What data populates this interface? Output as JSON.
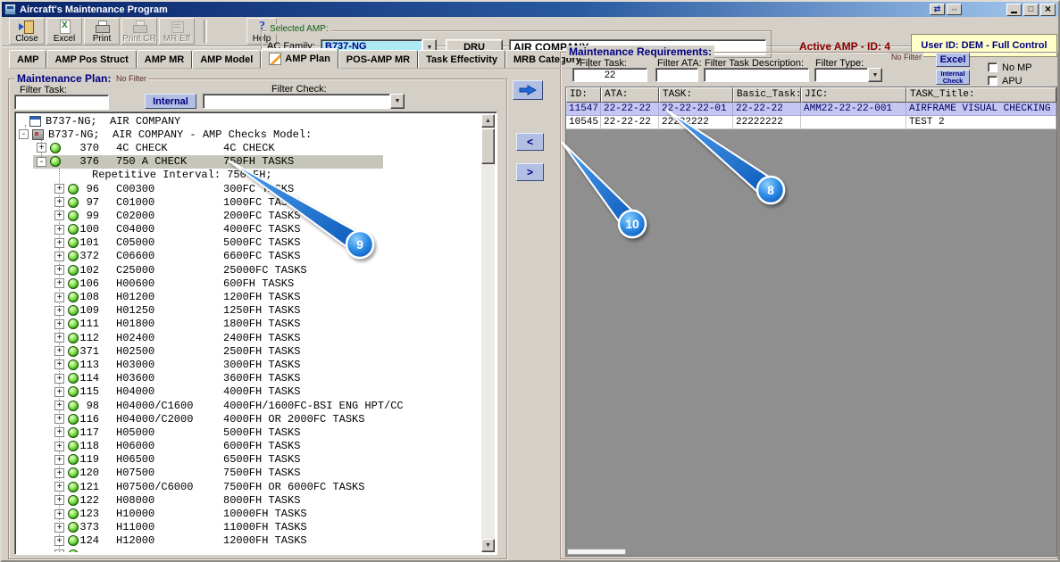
{
  "window": {
    "title": "Aircraft's Maintenance Program"
  },
  "toolbar": {
    "buttons": [
      {
        "label": "Close",
        "icon": "close-door-icon",
        "disabled": false
      },
      {
        "label": "Excel",
        "icon": "excel-icon",
        "disabled": false
      },
      {
        "label": "Print",
        "icon": "print-icon",
        "disabled": false
      },
      {
        "label": "Print CR",
        "icon": "print-cr-icon",
        "disabled": true
      },
      {
        "label": "MR Eff",
        "icon": "mr-eff-icon",
        "disabled": true
      },
      {
        "label": "Help",
        "icon": "help-icon",
        "disabled": false
      }
    ],
    "selected_amp_label": "Selected AMP:",
    "ac_family_label": "AC Family:",
    "ac_family_value": "B737-NG",
    "dru_button": "DRU",
    "company_value": "AIR COMPANY",
    "active_amp_text": "Active AMP - ID: 4",
    "user_text": "User ID: DEM - Full Control"
  },
  "tabs": [
    {
      "label": "AMP",
      "active": false
    },
    {
      "label": "AMP Pos Struct",
      "active": false
    },
    {
      "label": "AMP MR",
      "active": false
    },
    {
      "label": "AMP Model",
      "active": false
    },
    {
      "label": "AMP Plan",
      "active": true
    },
    {
      "label": "POS-AMP MR",
      "active": false
    },
    {
      "label": "Task Effectivity",
      "active": false
    },
    {
      "label": "MRB Category",
      "active": false
    }
  ],
  "plan": {
    "title": "Maintenance Plan:",
    "no_filter": "No Filter",
    "filter_task_label": "Filter Task:",
    "filter_task_value": "",
    "internal_button": "Internal",
    "filter_check_label": "Filter Check:",
    "tree": {
      "root": "B737-NG;  AIR COMPANY",
      "model": "B737-NG;  AIR COMPANY - AMP Checks Model:",
      "checks": [
        {
          "id": "370",
          "code": "4C CHECK",
          "desc": "4C CHECK",
          "expanded": false,
          "selected": false
        },
        {
          "id": "376",
          "code": "750 A CHECK",
          "desc": "750FH TASKS",
          "expanded": true,
          "selected": true
        }
      ],
      "interval": "Repetitive Interval: 750 FH;",
      "items": [
        {
          "id": "96",
          "code": "C00300",
          "desc": "300FC TASKS"
        },
        {
          "id": "97",
          "code": "C01000",
          "desc": "1000FC TASKS"
        },
        {
          "id": "99",
          "code": "C02000",
          "desc": "2000FC TASKS"
        },
        {
          "id": "100",
          "code": "C04000",
          "desc": "4000FC TASKS"
        },
        {
          "id": "101",
          "code": "C05000",
          "desc": "5000FC TASKS"
        },
        {
          "id": "372",
          "code": "C06600",
          "desc": "6600FC TASKS"
        },
        {
          "id": "102",
          "code": "C25000",
          "desc": "25000FC TASKS"
        },
        {
          "id": "106",
          "code": "H00600",
          "desc": "600FH TASKS"
        },
        {
          "id": "108",
          "code": "H01200",
          "desc": "1200FH TASKS"
        },
        {
          "id": "109",
          "code": "H01250",
          "desc": "1250FH TASKS"
        },
        {
          "id": "111",
          "code": "H01800",
          "desc": "1800FH TASKS"
        },
        {
          "id": "112",
          "code": "H02400",
          "desc": "2400FH TASKS"
        },
        {
          "id": "371",
          "code": "H02500",
          "desc": "2500FH TASKS"
        },
        {
          "id": "113",
          "code": "H03000",
          "desc": "3000FH TASKS"
        },
        {
          "id": "114",
          "code": "H03600",
          "desc": "3600FH TASKS"
        },
        {
          "id": "115",
          "code": "H04000",
          "desc": "4000FH TASKS"
        },
        {
          "id": "98",
          "code": "H04000/C1600",
          "desc": "4000FH/1600FC-BSI ENG HPT/CC"
        },
        {
          "id": "116",
          "code": "H04000/C2000",
          "desc": "4000FH OR 2000FC TASKS"
        },
        {
          "id": "117",
          "code": "H05000",
          "desc": "5000FH TASKS"
        },
        {
          "id": "118",
          "code": "H06000",
          "desc": "6000FH TASKS"
        },
        {
          "id": "119",
          "code": "H06500",
          "desc": "6500FH TASKS"
        },
        {
          "id": "120",
          "code": "H07500",
          "desc": "7500FH TASKS"
        },
        {
          "id": "121",
          "code": "H07500/C6000",
          "desc": "7500FH OR 6000FC TASKS"
        },
        {
          "id": "122",
          "code": "H08000",
          "desc": "8000FH TASKS"
        },
        {
          "id": "123",
          "code": "H10000",
          "desc": "10000FH TASKS"
        },
        {
          "id": "373",
          "code": "H11000",
          "desc": "11000FH TASKS"
        },
        {
          "id": "124",
          "code": "H12000",
          "desc": "12000FH TASKS"
        }
      ]
    }
  },
  "transfer": {
    "left": "<",
    "right": ">"
  },
  "requirements": {
    "title": "Maintenance Requirements:",
    "no_filter": "No Filter",
    "filter_task_label": "Filter Task:",
    "filter_task_value": "22",
    "filter_ata_label": "Filter ATA:",
    "filter_desc_label": "Filter Task Description:",
    "filter_type_label": "Filter Type:",
    "excel_button": "Excel",
    "internal_check_button": "Internal Check",
    "no_mp_label": "No MP",
    "apu_label": "APU",
    "table": {
      "columns": [
        "ID:",
        "ATA:",
        "TASK:",
        "Basic_Task:",
        "JIC:",
        "TASK_Title:"
      ],
      "rows": [
        {
          "id": "11547",
          "ata": "22-22-22",
          "task": "22-22-22-01",
          "basic": "22-22-22",
          "jic": "AMM22-22-22-001",
          "title": "AIRFRAME VISUAL CHECKING",
          "selected": true
        },
        {
          "id": "10545",
          "ata": "22-22-22",
          "task": "22222222",
          "basic": "22222222",
          "jic": "",
          "title": "TEST 2",
          "selected": false
        }
      ]
    }
  },
  "callouts": [
    {
      "n": "8"
    },
    {
      "n": "9"
    },
    {
      "n": "10"
    }
  ]
}
